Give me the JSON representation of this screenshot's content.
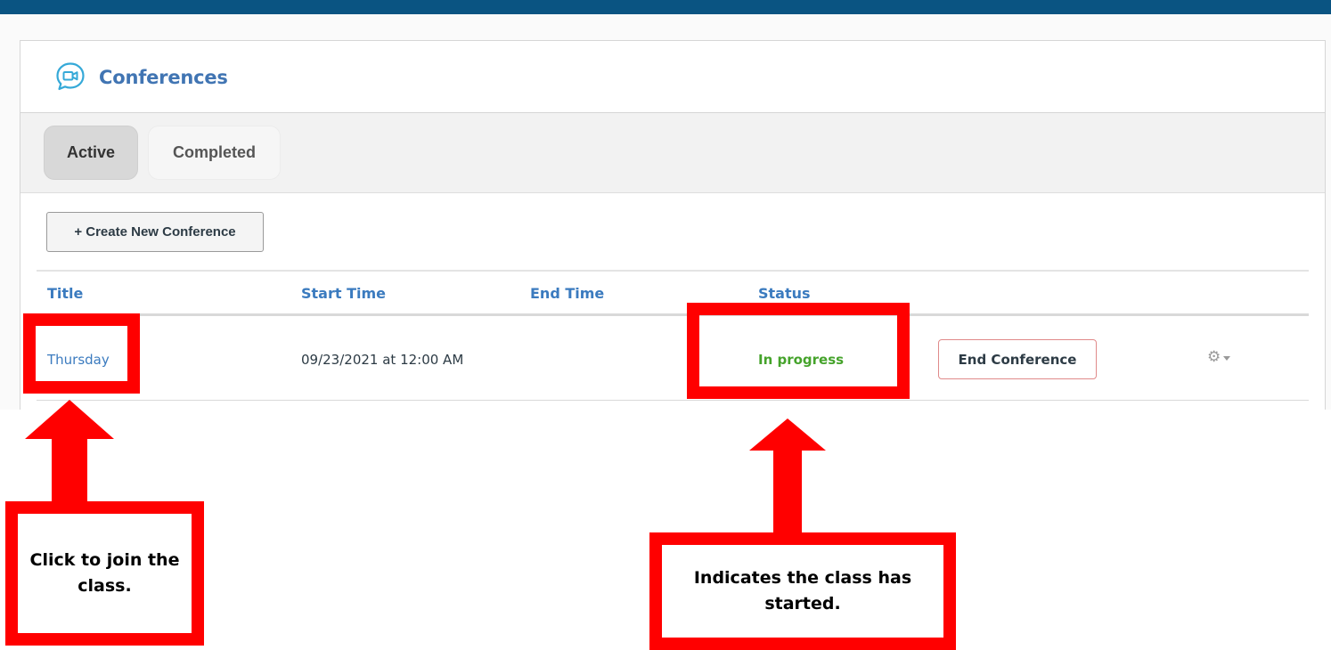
{
  "header": {
    "title": "Conferences",
    "icon": "video-chat-icon"
  },
  "tabs": [
    {
      "label": "Active",
      "selected": true
    },
    {
      "label": "Completed",
      "selected": false
    }
  ],
  "toolbar": {
    "create_label": "+ Create New Conference"
  },
  "table": {
    "columns": [
      "Title",
      "Start Time",
      "End Time",
      "Status"
    ],
    "rows": [
      {
        "title": "Thursday",
        "start_time": "09/23/2021 at 12:00 AM",
        "end_time": "",
        "status": "In progress",
        "action_label": "End Conference",
        "menu_icon": "gear-icon"
      }
    ]
  },
  "annotations": {
    "join_note": "Click to join the class.",
    "status_note": "Indicates the class has started."
  },
  "colors": {
    "top_bar": "#0a5482",
    "link": "#3b7bbf",
    "status_green": "#45a32b",
    "annotation_red": "#ff0000"
  }
}
